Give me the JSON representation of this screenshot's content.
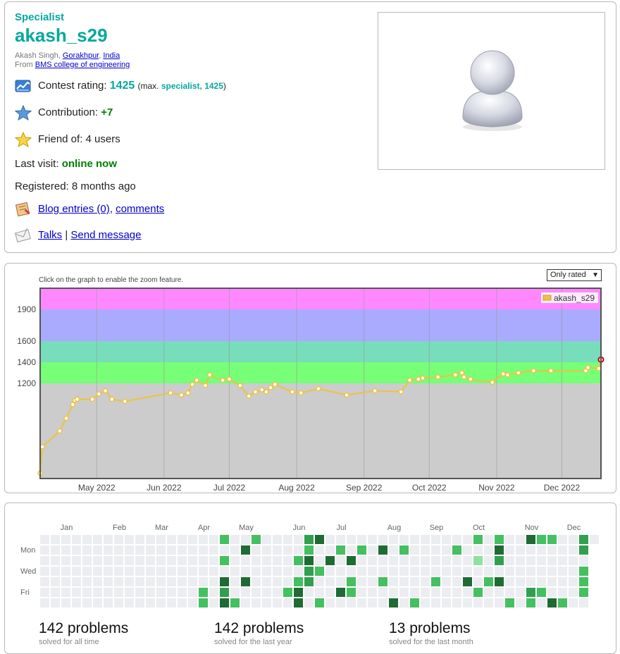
{
  "profile": {
    "rank": "Specialist",
    "handle": "akash_s29",
    "name_prefix": "Akash Singh, ",
    "city": "Gorakhpur",
    "sep": ", ",
    "country": "India",
    "from_prefix": "From ",
    "org": "BMS college of engineering",
    "rating_label": "Contest rating: ",
    "rating_value": "1425",
    "rating_max_open": "(max. ",
    "rating_max_rank": "specialist, 1425",
    "rating_max_close": ")",
    "contribution_label": "Contribution: ",
    "contribution_value": "+7",
    "friend_of": "Friend of: 4 users",
    "last_visit_label": "Last visit: ",
    "last_visit_value": "online now",
    "registered": "Registered: 8 months ago",
    "blog_link": "Blog entries (0)",
    "comments_link": "comments",
    "comma": ", ",
    "talks_link": "Talks",
    "pipe": " | ",
    "send_message_link": "Send message"
  },
  "rating_graph": {
    "hint": "Click on the graph to enable the zoom feature.",
    "select_value": "Only rated",
    "legend": "akash_s29",
    "colors": {
      "line": "#edc240",
      "gray": "#cccccc",
      "green": "#77ff77",
      "cyan": "#77ddbb",
      "blue": "#aaaaff",
      "pink": "#ff88ff",
      "last_point": "#cc0000"
    }
  },
  "chart_data": {
    "type": "line",
    "series": [
      {
        "name": "akash_s29",
        "values": [
          [
            "2022-04-05",
            350
          ],
          [
            "2022-04-06",
            600
          ],
          [
            "2022-04-14",
            750
          ],
          [
            "2022-04-17",
            870
          ],
          [
            "2022-04-20",
            1000
          ],
          [
            "2022-04-21",
            1040
          ],
          [
            "2022-04-22",
            1050
          ],
          [
            "2022-04-29",
            1050
          ],
          [
            "2022-05-02",
            1100
          ],
          [
            "2022-05-05",
            1130
          ],
          [
            "2022-05-08",
            1050
          ],
          [
            "2022-05-14",
            1030
          ],
          [
            "2022-06-04",
            1110
          ],
          [
            "2022-06-09",
            1090
          ],
          [
            "2022-06-12",
            1110
          ],
          [
            "2022-06-14",
            1190
          ],
          [
            "2022-06-16",
            1230
          ],
          [
            "2022-06-20",
            1180
          ],
          [
            "2022-06-22",
            1280
          ],
          [
            "2022-06-28",
            1230
          ],
          [
            "2022-07-01",
            1240
          ],
          [
            "2022-07-06",
            1180
          ],
          [
            "2022-07-10",
            1080
          ],
          [
            "2022-07-13",
            1120
          ],
          [
            "2022-07-16",
            1140
          ],
          [
            "2022-07-18",
            1120
          ],
          [
            "2022-07-20",
            1160
          ],
          [
            "2022-07-22",
            1190
          ],
          [
            "2022-07-30",
            1120
          ],
          [
            "2022-08-03",
            1110
          ],
          [
            "2022-08-11",
            1150
          ],
          [
            "2022-08-24",
            1090
          ],
          [
            "2022-09-06",
            1130
          ],
          [
            "2022-09-18",
            1120
          ],
          [
            "2022-09-22",
            1230
          ],
          [
            "2022-09-26",
            1240
          ],
          [
            "2022-09-28",
            1250
          ],
          [
            "2022-10-05",
            1260
          ],
          [
            "2022-10-13",
            1280
          ],
          [
            "2022-10-16",
            1300
          ],
          [
            "2022-10-17",
            1260
          ],
          [
            "2022-10-20",
            1240
          ],
          [
            "2022-10-30",
            1210
          ],
          [
            "2022-11-04",
            1290
          ],
          [
            "2022-11-06",
            1280
          ],
          [
            "2022-11-11",
            1300
          ],
          [
            "2022-11-18",
            1320
          ],
          [
            "2022-11-26",
            1320
          ],
          [
            "2022-12-12",
            1320
          ],
          [
            "2022-12-13",
            1350
          ],
          [
            "2022-12-18",
            1340
          ],
          [
            "2022-12-19",
            1425
          ]
        ]
      }
    ],
    "x_ticks": [
      "May 2022",
      "Jun 2022",
      "Jul 2022",
      "Aug 2022",
      "Sep 2022",
      "Oct 2022",
      "Nov 2022",
      "Dec 2022"
    ],
    "y_ticks": [
      1200,
      1400,
      1600,
      1900
    ],
    "ylim": [
      300,
      2100
    ],
    "xlim": [
      "2022-04-05",
      "2022-12-19"
    ],
    "bands": [
      {
        "from": 300,
        "to": 1200,
        "color": "#cccccc"
      },
      {
        "from": 1200,
        "to": 1400,
        "color": "#77ff77"
      },
      {
        "from": 1400,
        "to": 1600,
        "color": "#77ddbb"
      },
      {
        "from": 1600,
        "to": 1900,
        "color": "#aaaaff"
      },
      {
        "from": 1900,
        "to": 2100,
        "color": "#ff88ff"
      }
    ],
    "grid": true,
    "legend_position": "top-right"
  },
  "heatmap": {
    "months": [
      "Jan",
      "Feb",
      "Mar",
      "Apr",
      "May",
      "Jun",
      "Jul",
      "Aug",
      "Sep",
      "Oct",
      "Nov",
      "Dec"
    ],
    "days": [
      "Mon",
      "Wed",
      "Fri"
    ],
    "colors": {
      "empty": "#ebedf0",
      "l1": "#90e0a0",
      "l2": "#44c060",
      "l3": "#30a050",
      "l4": "#1e6b34"
    },
    "cells": [
      [
        17,
        0,
        2
      ],
      [
        20,
        0,
        2
      ],
      [
        25,
        0,
        3
      ],
      [
        26,
        0,
        4
      ],
      [
        41,
        0,
        2
      ],
      [
        43,
        0,
        2
      ],
      [
        46,
        0,
        4
      ],
      [
        47,
        0,
        2
      ],
      [
        48,
        0,
        2
      ],
      [
        51,
        0,
        3
      ],
      [
        19,
        1,
        4
      ],
      [
        25,
        1,
        2
      ],
      [
        28,
        1,
        2
      ],
      [
        30,
        1,
        2
      ],
      [
        32,
        1,
        4
      ],
      [
        34,
        1,
        2
      ],
      [
        39,
        1,
        2
      ],
      [
        43,
        1,
        4
      ],
      [
        51,
        1,
        3
      ],
      [
        17,
        2,
        2
      ],
      [
        24,
        2,
        2
      ],
      [
        25,
        2,
        4
      ],
      [
        27,
        2,
        4
      ],
      [
        29,
        2,
        4
      ],
      [
        43,
        2,
        3
      ],
      [
        41,
        2,
        1
      ],
      [
        25,
        3,
        3
      ],
      [
        26,
        3,
        2
      ],
      [
        51,
        3,
        2
      ],
      [
        17,
        4,
        4
      ],
      [
        19,
        4,
        4
      ],
      [
        24,
        4,
        2
      ],
      [
        25,
        4,
        3
      ],
      [
        29,
        4,
        2
      ],
      [
        32,
        4,
        2
      ],
      [
        37,
        4,
        2
      ],
      [
        40,
        4,
        4
      ],
      [
        42,
        4,
        2
      ],
      [
        43,
        4,
        4
      ],
      [
        51,
        4,
        2
      ],
      [
        15,
        5,
        2
      ],
      [
        17,
        5,
        3
      ],
      [
        23,
        5,
        2
      ],
      [
        24,
        5,
        4
      ],
      [
        28,
        5,
        4
      ],
      [
        29,
        5,
        2
      ],
      [
        46,
        5,
        3
      ],
      [
        47,
        5,
        2
      ],
      [
        51,
        5,
        2
      ],
      [
        41,
        5,
        2
      ],
      [
        15,
        6,
        2
      ],
      [
        17,
        6,
        4
      ],
      [
        18,
        6,
        2
      ],
      [
        24,
        6,
        4
      ],
      [
        26,
        6,
        2
      ],
      [
        33,
        6,
        4
      ],
      [
        35,
        6,
        2
      ],
      [
        44,
        6,
        2
      ],
      [
        46,
        6,
        2
      ],
      [
        48,
        6,
        4
      ],
      [
        49,
        6,
        2
      ]
    ]
  },
  "stats": [
    {
      "num": "142 problems",
      "label": "solved for all time"
    },
    {
      "num": "142 problems",
      "label": "solved for the last year"
    },
    {
      "num": "13 problems",
      "label": "solved for the last month"
    }
  ]
}
